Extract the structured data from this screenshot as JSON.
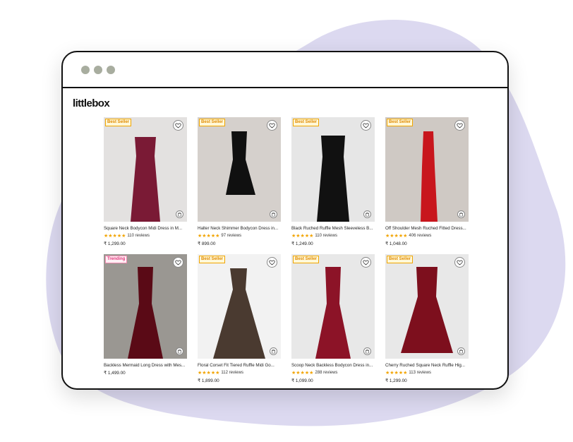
{
  "brand": "littlebox",
  "colors": {
    "accent_blob": "#dcd9f0",
    "star": "#f2a400",
    "badge_best": "#e08a00",
    "badge_trending": "#e0357a"
  },
  "products": [
    {
      "badge": "Best Seller",
      "badge_type": "best",
      "title": "Square Neck Bodycon Midi Dress in M...",
      "stars": "★★★★★",
      "reviews": "110 reviews",
      "price": "₹ 1,299.00",
      "img_bg": "#e3e1e0",
      "dress": "#7a1a35"
    },
    {
      "badge": "Best Seller",
      "badge_type": "best",
      "title": "Halter Neck Shimmer Bodycon Dress in...",
      "stars": "★★★★★",
      "reviews": "97 reviews",
      "price": "₹ 899.00",
      "img_bg": "#d5d0cc",
      "dress": "#101010"
    },
    {
      "badge": "Best Seller",
      "badge_type": "best",
      "title": "Black Ruched Ruffle Mesh Sleeveless B...",
      "stars": "★★★★★",
      "reviews": "110 reviews",
      "price": "₹ 1,249.00",
      "img_bg": "#e6e6e6",
      "dress": "#111111"
    },
    {
      "badge": "Best Seller",
      "badge_type": "best",
      "title": "Off Shoulder Mesh Ruched Fitted Dress...",
      "stars": "★★★★★",
      "reviews": "406 reviews",
      "price": "₹ 1,048.00",
      "img_bg": "#cfc9c4",
      "dress": "#c8161d"
    },
    {
      "badge": "Trending",
      "badge_type": "trending",
      "title": "Backless Mermaid Long Dress with Mes...",
      "stars": "",
      "reviews": "",
      "price": "₹ 1,499.00",
      "img_bg": "#9a9792",
      "dress": "#5a0a16"
    },
    {
      "badge": "Best Seller",
      "badge_type": "best",
      "title": "Floral Corset Fit Tiered Ruffle Midi Go...",
      "stars": "★★★★★",
      "reviews": "112 reviews",
      "price": "₹ 1,899.00",
      "img_bg": "#f2f2f2",
      "dress": "#4a3a30"
    },
    {
      "badge": "Best Seller",
      "badge_type": "best",
      "title": "Scoop Neck Backless Bodycon Dress in...",
      "stars": "★★★★★",
      "reviews": "288 reviews",
      "price": "₹ 1,099.00",
      "img_bg": "#e8e8e8",
      "dress": "#8c1327"
    },
    {
      "badge": "Best Seller",
      "badge_type": "best",
      "title": "Cherry Ruched Square Neck Ruffle Hig...",
      "stars": "★★★★★",
      "reviews": "113 reviews",
      "price": "₹ 1,299.00",
      "img_bg": "#e8e8e8",
      "dress": "#7d0f1d"
    }
  ]
}
